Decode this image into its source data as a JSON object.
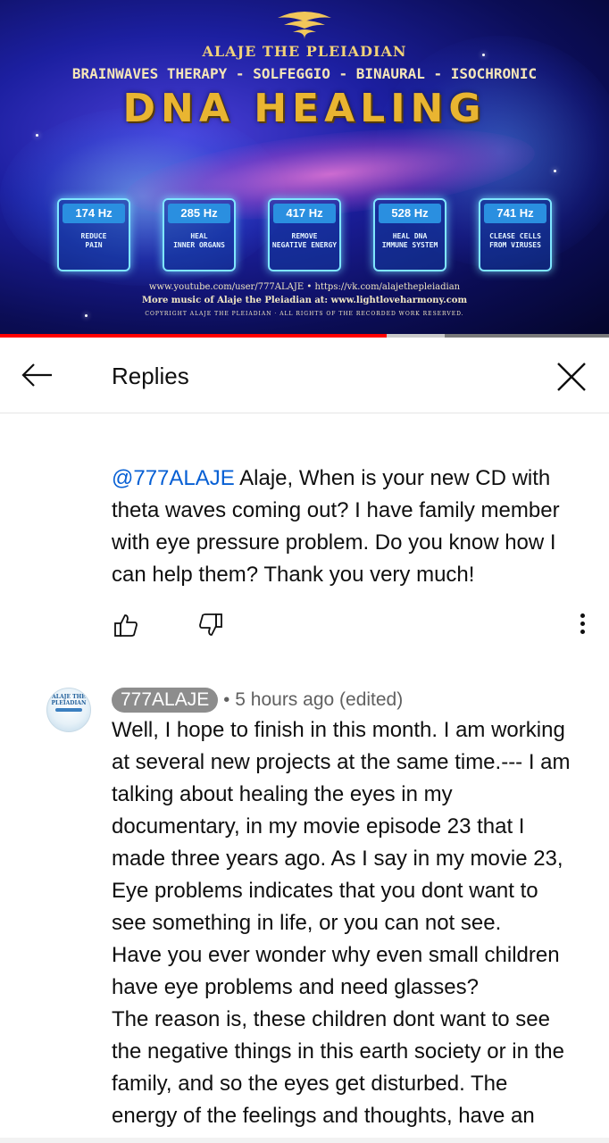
{
  "video": {
    "brand": "ALAJE THE PLEIADIAN",
    "subtitle": "BRAINWAVES THERAPY - SOLFEGGIO - BINAURAL - ISOCHRONIC",
    "title": "DNA HEALING",
    "frequencies": [
      {
        "hz": "174 Hz",
        "desc1": "REDUCE",
        "desc2": "PAIN"
      },
      {
        "hz": "285 Hz",
        "desc1": "HEAL",
        "desc2": "INNER ORGANS"
      },
      {
        "hz": "417 Hz",
        "desc1": "REMOVE",
        "desc2": "NEGATIVE ENERGY"
      },
      {
        "hz": "528 Hz",
        "desc1": "HEAL DNA",
        "desc2": "IMMUNE SYSTEM"
      },
      {
        "hz": "741 Hz",
        "desc1": "CLEASE CELLS",
        "desc2": "FROM VIRUSES"
      }
    ],
    "credit_line1": "www.youtube.com/user/777ALAJE  • https://vk.com/alajethepleiadian",
    "credit_line2": "More music of Alaje the Pleiadian at: www.lightloveharmony.com",
    "credit_line3": "COPYRIGHT ALAJE THE PLEIADIAN · ALL RIGHTS OF THE RECORDED WORK RESERVED.",
    "progress_played": 0.635,
    "progress_buffered": 0.73,
    "colors": {
      "progress": "#ff0000",
      "title_gold": "#e9b531",
      "freq_border": "#7fe6ff"
    }
  },
  "header": {
    "title": "Replies",
    "back_icon": "arrow-left-icon",
    "close_icon": "close-icon"
  },
  "parent_comment": {
    "mention": "@777ALAJE",
    "text": " Alaje, When is your new CD with theta waves coming out? I have family member with eye pressure problem. Do you know how I can help them? Thank you very much!",
    "actions": {
      "like_icon": "thumbs-up-icon",
      "dislike_icon": "thumbs-down-icon",
      "more_icon": "more-vertical-icon"
    }
  },
  "reply": {
    "avatar_text": "ALAJE THE PLEIADIAN",
    "author": "777ALAJE",
    "separator": "•",
    "time": "5 hours ago (edited)",
    "lines": [
      "Well, I hope to finish in this month. I am working",
      "at several new projects at the same time.--- I am",
      "talking about healing the eyes in my",
      "documentary, in my movie episode 23 that I",
      "made three years ago. As I say in my movie 23,",
      "Eye problems indicates that you dont want to",
      "see something in life, or you can not see.",
      "Have you ever wonder why even small children",
      "have eye problems and need glasses?",
      "The reason is, these children dont want to see",
      "the negative things in this earth society or in the",
      "family, and so the eyes get disturbed. The",
      "energy of the feelings and thoughts, have an"
    ]
  }
}
